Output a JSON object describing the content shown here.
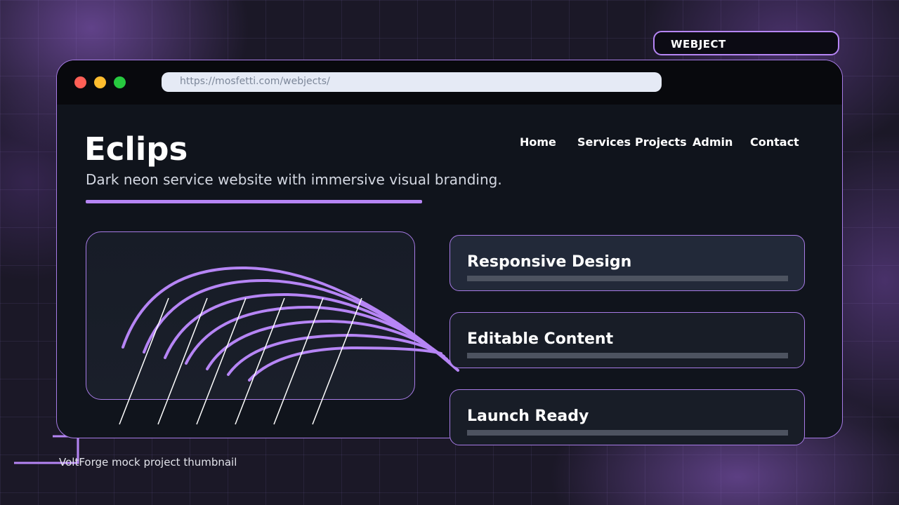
{
  "badge": {
    "label": "WEBJECT"
  },
  "browser": {
    "url": "https://mosfetti.com/webjects/",
    "controls": [
      "close-dot",
      "minimize-dot",
      "maximize-dot"
    ]
  },
  "site": {
    "brand": "Eclips",
    "tagline": "Dark neon service website with immersive visual branding.",
    "nav": [
      "Home",
      "Services",
      "Projects",
      "Admin",
      "Contact"
    ],
    "features": [
      {
        "title": "Responsive Design"
      },
      {
        "title": "Editable Content"
      },
      {
        "title": "Launch Ready"
      }
    ]
  },
  "caption": "VoltForge mock project thumbnail",
  "colors": {
    "accent": "#b685f5",
    "window_bg": "#10141c",
    "titlebar_bg": "#08090d",
    "page_bg": "#1b1827"
  }
}
